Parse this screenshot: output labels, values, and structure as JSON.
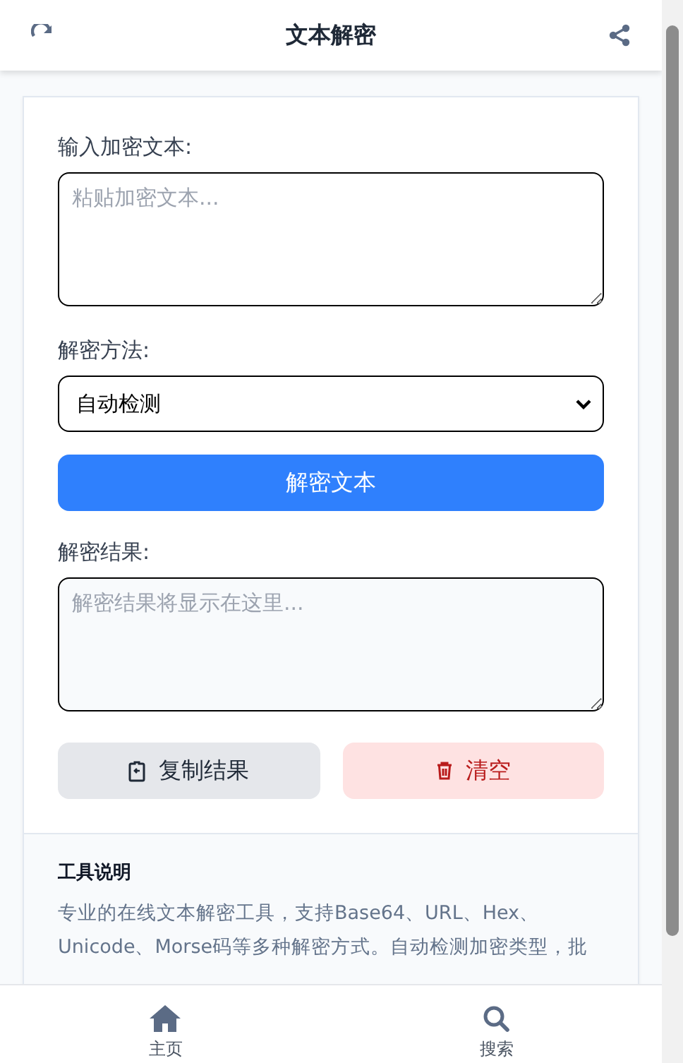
{
  "header": {
    "title": "文本解密"
  },
  "input": {
    "label": "输入加密文本:",
    "placeholder": "粘贴加密文本..."
  },
  "method": {
    "label": "解密方法:",
    "value": "自动检测"
  },
  "decrypt_button": "解密文本",
  "result": {
    "label": "解密结果:",
    "placeholder": "解密结果将显示在这里..."
  },
  "actions": [
    {
      "kind": "copy",
      "label": "复制结果"
    },
    {
      "kind": "clear",
      "label": "清空"
    }
  ],
  "info": {
    "title": "工具说明",
    "text": "专业的在线文本解密工具，支持Base64、URL、Hex、Unicode、Morse码等多种解密方式。自动检测加密类型，批"
  },
  "nav": [
    {
      "kind": "home",
      "label": "主页"
    },
    {
      "kind": "search",
      "label": "搜索"
    }
  ]
}
